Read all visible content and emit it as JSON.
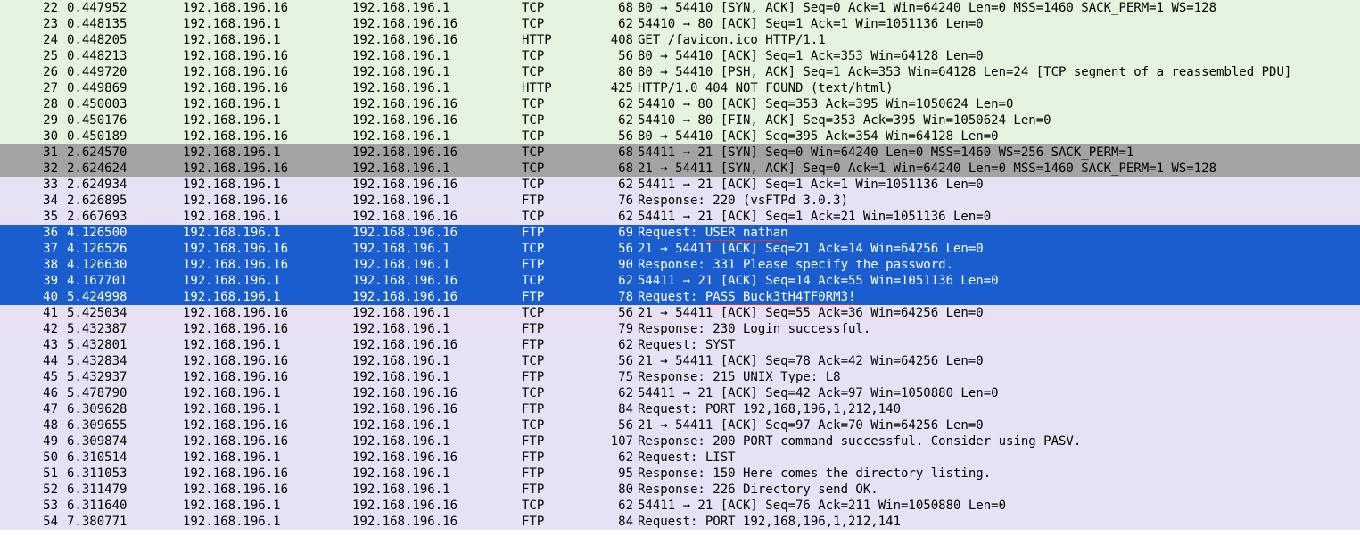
{
  "packets": [
    {
      "no": "22",
      "time": "0.447952",
      "src": "192.168.196.16",
      "dst": "192.168.196.1",
      "prot": "TCP",
      "len": "68",
      "info": "80 → 54410 [SYN, ACK] Seq=0 Ack=1 Win=64240 Len=0 MSS=1460 SACK_PERM=1 WS=128",
      "color": "green"
    },
    {
      "no": "23",
      "time": "0.448135",
      "src": "192.168.196.1",
      "dst": "192.168.196.16",
      "prot": "TCP",
      "len": "62",
      "info": "54410 → 80 [ACK] Seq=1 Ack=1 Win=1051136 Len=0",
      "color": "green"
    },
    {
      "no": "24",
      "time": "0.448205",
      "src": "192.168.196.1",
      "dst": "192.168.196.16",
      "prot": "HTTP",
      "len": "408",
      "info": "GET /favicon.ico HTTP/1.1",
      "color": "green"
    },
    {
      "no": "25",
      "time": "0.448213",
      "src": "192.168.196.16",
      "dst": "192.168.196.1",
      "prot": "TCP",
      "len": "56",
      "info": "80 → 54410 [ACK] Seq=1 Ack=353 Win=64128 Len=0",
      "color": "green"
    },
    {
      "no": "26",
      "time": "0.449720",
      "src": "192.168.196.16",
      "dst": "192.168.196.1",
      "prot": "TCP",
      "len": "80",
      "info": "80 → 54410 [PSH, ACK] Seq=1 Ack=353 Win=64128 Len=24 [TCP segment of a reassembled PDU]",
      "color": "green"
    },
    {
      "no": "27",
      "time": "0.449869",
      "src": "192.168.196.16",
      "dst": "192.168.196.1",
      "prot": "HTTP",
      "len": "425",
      "info": "HTTP/1.0 404 NOT FOUND  (text/html)",
      "color": "green"
    },
    {
      "no": "28",
      "time": "0.450003",
      "src": "192.168.196.1",
      "dst": "192.168.196.16",
      "prot": "TCP",
      "len": "62",
      "info": "54410 → 80 [ACK] Seq=353 Ack=395 Win=1050624 Len=0",
      "color": "green"
    },
    {
      "no": "29",
      "time": "0.450176",
      "src": "192.168.196.1",
      "dst": "192.168.196.16",
      "prot": "TCP",
      "len": "62",
      "info": "54410 → 80 [FIN, ACK] Seq=353 Ack=395 Win=1050624 Len=0",
      "color": "green"
    },
    {
      "no": "30",
      "time": "0.450189",
      "src": "192.168.196.16",
      "dst": "192.168.196.1",
      "prot": "TCP",
      "len": "56",
      "info": "80 → 54410 [ACK] Seq=395 Ack=354 Win=64128 Len=0",
      "color": "green"
    },
    {
      "no": "31",
      "time": "2.624570",
      "src": "192.168.196.1",
      "dst": "192.168.196.16",
      "prot": "TCP",
      "len": "68",
      "info": "54411 → 21 [SYN] Seq=0 Win=64240 Len=0 MSS=1460 WS=256 SACK_PERM=1",
      "color": "grey"
    },
    {
      "no": "32",
      "time": "2.624624",
      "src": "192.168.196.16",
      "dst": "192.168.196.1",
      "prot": "TCP",
      "len": "68",
      "info": "21 → 54411 [SYN, ACK] Seq=0 Ack=1 Win=64240 Len=0 MSS=1460 SACK_PERM=1 WS=128",
      "color": "grey"
    },
    {
      "no": "33",
      "time": "2.624934",
      "src": "192.168.196.1",
      "dst": "192.168.196.16",
      "prot": "TCP",
      "len": "62",
      "info": "54411 → 21 [ACK] Seq=1 Ack=1 Win=1051136 Len=0",
      "color": "purple"
    },
    {
      "no": "34",
      "time": "2.626895",
      "src": "192.168.196.16",
      "dst": "192.168.196.1",
      "prot": "FTP",
      "len": "76",
      "info": "Response: 220 (vsFTPd 3.0.3)",
      "color": "purple"
    },
    {
      "no": "35",
      "time": "2.667693",
      "src": "192.168.196.1",
      "dst": "192.168.196.16",
      "prot": "TCP",
      "len": "62",
      "info": "54411 → 21 [ACK] Seq=1 Ack=21 Win=1051136 Len=0",
      "color": "purple"
    },
    {
      "no": "36",
      "time": "4.126500",
      "src": "192.168.196.1",
      "dst": "192.168.196.16",
      "prot": "FTP",
      "len": "69",
      "info_prefix": "Request: ",
      "info_underlined": "USER nathan",
      "color": "selected"
    },
    {
      "no": "37",
      "time": "4.126526",
      "src": "192.168.196.16",
      "dst": "192.168.196.1",
      "prot": "TCP",
      "len": "56",
      "info": "21 → 54411 [ACK] Seq=21 Ack=14 Win=64256 Len=0",
      "color": "selected"
    },
    {
      "no": "38",
      "time": "4.126630",
      "src": "192.168.196.16",
      "dst": "192.168.196.1",
      "prot": "FTP",
      "len": "90",
      "info": "Response: 331 Please specify the password.",
      "color": "selected"
    },
    {
      "no": "39",
      "time": "4.167701",
      "src": "192.168.196.1",
      "dst": "192.168.196.16",
      "prot": "TCP",
      "len": "62",
      "info": "54411 → 21 [ACK] Seq=14 Ack=55 Win=1051136 Len=0",
      "color": "selected"
    },
    {
      "no": "40",
      "time": "5.424998",
      "src": "192.168.196.1",
      "dst": "192.168.196.16",
      "prot": "FTP",
      "len": "78",
      "info_prefix": "Request: ",
      "info_underlined": "PASS Buck3tH4TF0RM3!",
      "color": "selected"
    },
    {
      "no": "41",
      "time": "5.425034",
      "src": "192.168.196.16",
      "dst": "192.168.196.1",
      "prot": "TCP",
      "len": "56",
      "info": "21 → 54411 [ACK] Seq=55 Ack=36 Win=64256 Len=0",
      "color": "purple"
    },
    {
      "no": "42",
      "time": "5.432387",
      "src": "192.168.196.16",
      "dst": "192.168.196.1",
      "prot": "FTP",
      "len": "79",
      "info": "Response: 230 Login successful.",
      "color": "purple"
    },
    {
      "no": "43",
      "time": "5.432801",
      "src": "192.168.196.1",
      "dst": "192.168.196.16",
      "prot": "FTP",
      "len": "62",
      "info": "Request: SYST",
      "color": "purple"
    },
    {
      "no": "44",
      "time": "5.432834",
      "src": "192.168.196.16",
      "dst": "192.168.196.1",
      "prot": "TCP",
      "len": "56",
      "info": "21 → 54411 [ACK] Seq=78 Ack=42 Win=64256 Len=0",
      "color": "purple"
    },
    {
      "no": "45",
      "time": "5.432937",
      "src": "192.168.196.16",
      "dst": "192.168.196.1",
      "prot": "FTP",
      "len": "75",
      "info": "Response: 215 UNIX Type: L8",
      "color": "purple"
    },
    {
      "no": "46",
      "time": "5.478790",
      "src": "192.168.196.1",
      "dst": "192.168.196.16",
      "prot": "TCP",
      "len": "62",
      "info": "54411 → 21 [ACK] Seq=42 Ack=97 Win=1050880 Len=0",
      "color": "purple"
    },
    {
      "no": "47",
      "time": "6.309628",
      "src": "192.168.196.1",
      "dst": "192.168.196.16",
      "prot": "FTP",
      "len": "84",
      "info": "Request: PORT 192,168,196,1,212,140",
      "color": "purple"
    },
    {
      "no": "48",
      "time": "6.309655",
      "src": "192.168.196.16",
      "dst": "192.168.196.1",
      "prot": "TCP",
      "len": "56",
      "info": "21 → 54411 [ACK] Seq=97 Ack=70 Win=64256 Len=0",
      "color": "purple"
    },
    {
      "no": "49",
      "time": "6.309874",
      "src": "192.168.196.16",
      "dst": "192.168.196.1",
      "prot": "FTP",
      "len": "107",
      "info": "Response: 200 PORT command successful. Consider using PASV.",
      "color": "purple"
    },
    {
      "no": "50",
      "time": "6.310514",
      "src": "192.168.196.1",
      "dst": "192.168.196.16",
      "prot": "FTP",
      "len": "62",
      "info": "Request: LIST",
      "color": "purple"
    },
    {
      "no": "51",
      "time": "6.311053",
      "src": "192.168.196.16",
      "dst": "192.168.196.1",
      "prot": "FTP",
      "len": "95",
      "info": "Response: 150 Here comes the directory listing.",
      "color": "purple"
    },
    {
      "no": "52",
      "time": "6.311479",
      "src": "192.168.196.16",
      "dst": "192.168.196.1",
      "prot": "FTP",
      "len": "80",
      "info": "Response: 226 Directory send OK.",
      "color": "purple"
    },
    {
      "no": "53",
      "time": "6.311640",
      "src": "192.168.196.1",
      "dst": "192.168.196.16",
      "prot": "TCP",
      "len": "62",
      "info": "54411 → 21 [ACK] Seq=76 Ack=211 Win=1050880 Len=0",
      "color": "purple"
    },
    {
      "no": "54",
      "time": "7.380771",
      "src": "192.168.196.1",
      "dst": "192.168.196.16",
      "prot": "FTP",
      "len": "84",
      "info": "Request: PORT 192,168,196,1,212,141",
      "color": "purple"
    }
  ]
}
